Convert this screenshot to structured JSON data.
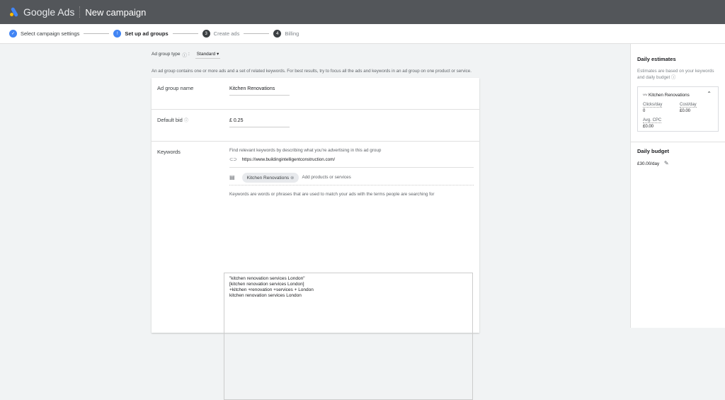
{
  "header": {
    "brand": "Google Ads",
    "title": "New campaign"
  },
  "steps": [
    {
      "num": "✓",
      "label": "Select campaign settings",
      "state": "done"
    },
    {
      "num": "!",
      "label": "Set up ad groups",
      "state": "current"
    },
    {
      "num": "3",
      "label": "Create ads",
      "state": "todo"
    },
    {
      "num": "4",
      "label": "Billing",
      "state": "todo"
    }
  ],
  "colors": {
    "accent": "#4285f4",
    "header": "#53565a"
  },
  "ad_group_type": {
    "label": "Ad group type",
    "separator": ":",
    "value": "Standard"
  },
  "description": "An ad group contains one or more ads and a set of related keywords. For best results, try to focus all the ads and keywords in an ad group on one product or service.",
  "ad_group_name": {
    "label": "Ad group name",
    "value": "Kitchen Renovations"
  },
  "default_bid": {
    "label": "Default bid",
    "value": "£ 0.25"
  },
  "keywords": {
    "label": "Keywords",
    "find_hint": "Find relevant keywords by describing what you're advertising in this ad group",
    "url": "https://www.buildingintelligentconstruction.com/",
    "chip": "Kitchen Renovations",
    "add_placeholder": "Add products or services",
    "info": "Keywords are words or phrases that are used to match your ads with the terms people are searching for",
    "text": "\"kitchen renovation services London\"\n[kitchen renovation services London]\n+kitchen +renovation +services + London\nkitchen renovation services London"
  },
  "sidebar": {
    "estimates_title": "Daily estimates",
    "estimates_desc": "Estimates are based on your keywords and daily budget",
    "group": "Kitchen Renovations",
    "clicks_label": "Clicks/day",
    "clicks": "0",
    "cost_label": "Cost/day",
    "cost": "£0.00",
    "cpc_label": "Avg. CPC",
    "cpc": "£0.00",
    "budget_title": "Daily budget",
    "budget": "£30.00/day"
  }
}
